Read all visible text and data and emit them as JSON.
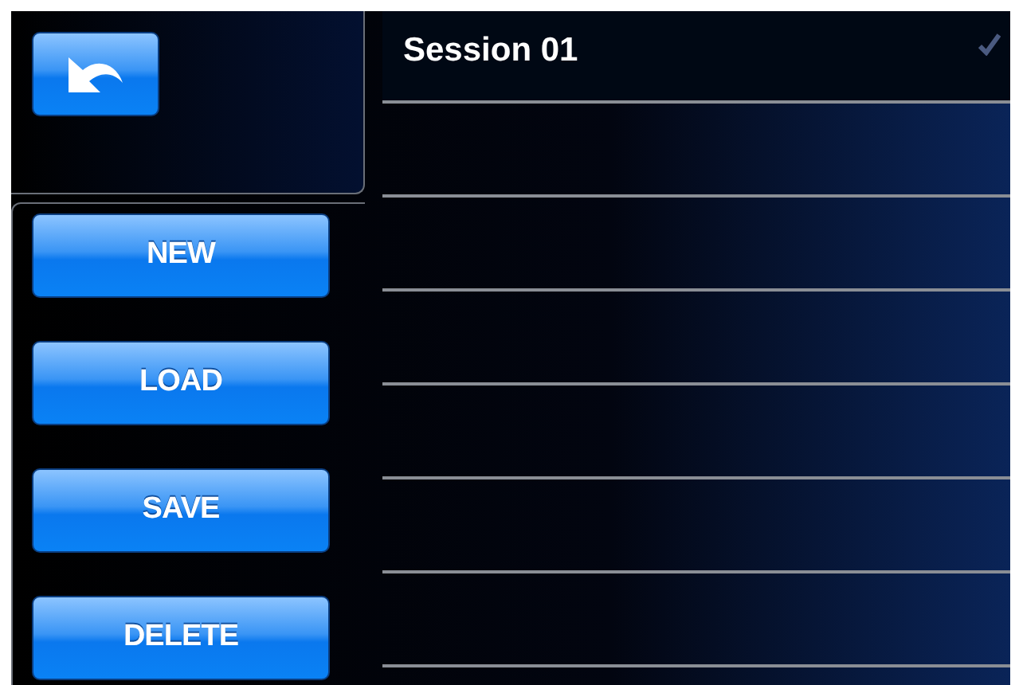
{
  "buttons": [
    {
      "label": "NEW"
    },
    {
      "label": "LOAD"
    },
    {
      "label": "SAVE"
    },
    {
      "label": "DELETE"
    }
  ],
  "sessions": [
    {
      "name": "Session 01",
      "selected": true
    }
  ]
}
